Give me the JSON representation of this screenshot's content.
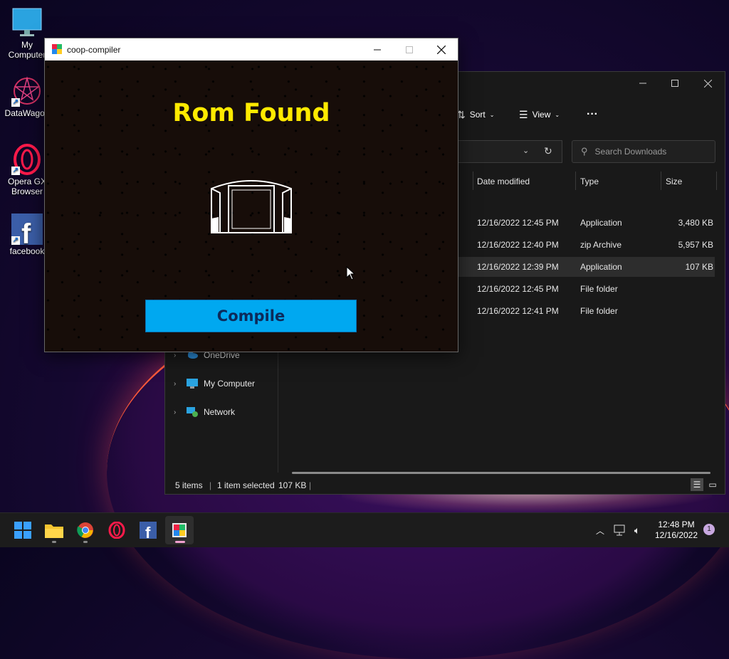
{
  "desktop": {
    "icons": [
      {
        "label": "My Computer"
      },
      {
        "label": "DataWagon"
      },
      {
        "label": "Opera GX Browser"
      },
      {
        "label": "facebook"
      }
    ]
  },
  "explorer": {
    "toolbar": {
      "sort_label": "Sort",
      "view_label": "View",
      "more_label": "···"
    },
    "search": {
      "placeholder": "Search Downloads"
    },
    "columns": {
      "date": "Date modified",
      "type": "Type",
      "size": "Size"
    },
    "rows": [
      {
        "date": "12/16/2022 12:45 PM",
        "type": "Application",
        "size": "3,480 KB"
      },
      {
        "date": "12/16/2022 12:40 PM",
        "type": "zip Archive",
        "size": "5,957 KB"
      },
      {
        "date": "12/16/2022 12:39 PM",
        "type": "Application",
        "size": "107 KB"
      },
      {
        "date": "12/16/2022 12:45 PM",
        "type": "File folder",
        "size": ""
      },
      {
        "date": "12/16/2022 12:41 PM",
        "type": "File folder",
        "size": ""
      }
    ],
    "nav": [
      {
        "label": "OneDrive"
      },
      {
        "label": "My Computer"
      },
      {
        "label": "Network"
      }
    ],
    "status": {
      "items": "5 items",
      "selected": "1 item selected",
      "size": "107 KB"
    }
  },
  "coop": {
    "title": "coop-compiler",
    "heading": "Rom Found",
    "compile_label": "Compile",
    "colors": {
      "heading": "#ffea00",
      "button": "#00a8f0",
      "button_text": "#0c2a5a"
    }
  },
  "taskbar": {
    "time": "12:48 PM",
    "date": "12/16/2022",
    "notifications": "1"
  }
}
